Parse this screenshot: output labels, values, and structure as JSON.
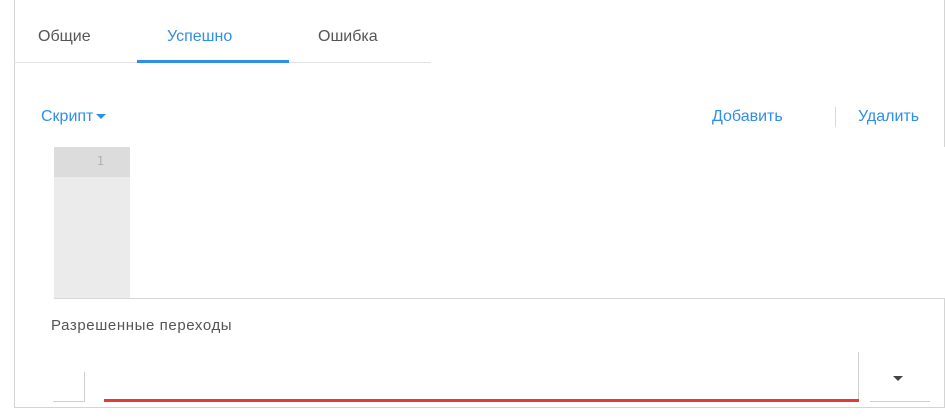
{
  "tabs": [
    {
      "label": "Общие",
      "active": false
    },
    {
      "label": "Успешно",
      "active": true
    },
    {
      "label": "Ошибка",
      "active": false
    }
  ],
  "script": {
    "dropdown_label": "Скрипт",
    "add_label": "Добавить",
    "remove_label": "Удалить"
  },
  "editor": {
    "line_number": "1",
    "content": ""
  },
  "transitions": {
    "label": "Разрешенные переходы",
    "selected_value": "",
    "checked": false
  },
  "colors": {
    "accent": "#2f8ee8",
    "error_underline": "#e53935",
    "gutter": "#ebebeb"
  },
  "icons": {
    "script_dropdown": "caret-down-icon",
    "select_arrow": "arrow-down-icon"
  }
}
